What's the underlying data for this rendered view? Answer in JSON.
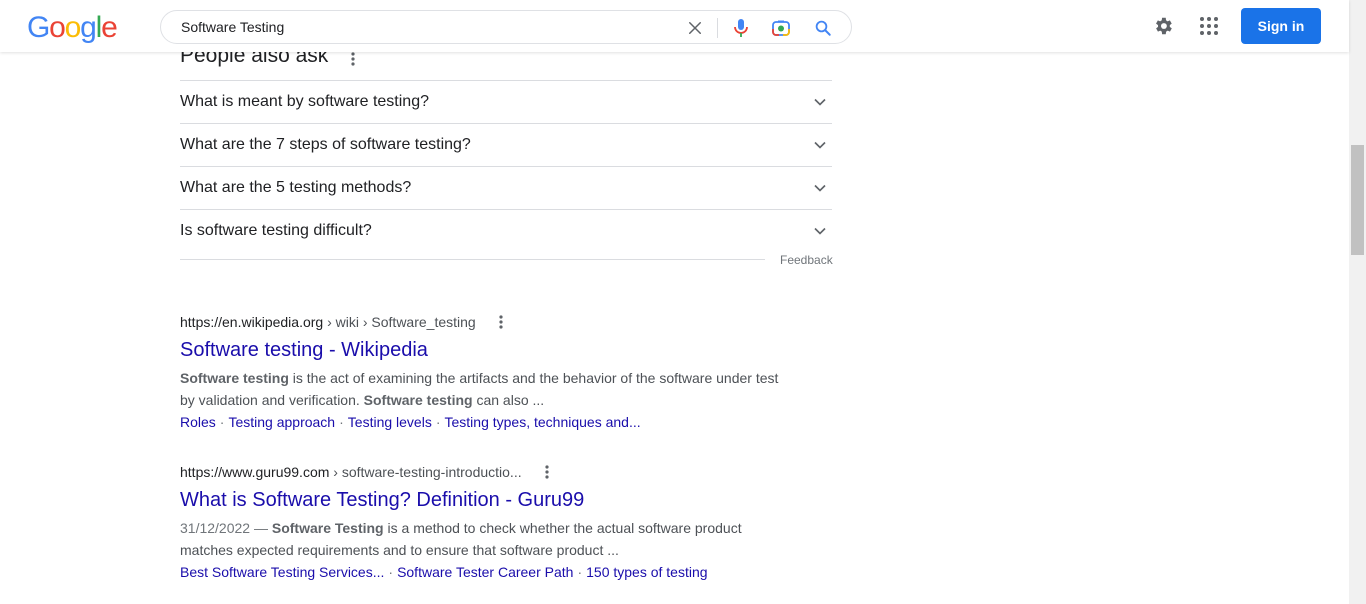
{
  "header": {
    "logo_letters": [
      {
        "ch": "G",
        "color": "#4285f4"
      },
      {
        "ch": "o",
        "color": "#ea4335"
      },
      {
        "ch": "o",
        "color": "#fbbc05"
      },
      {
        "ch": "g",
        "color": "#4285f4"
      },
      {
        "ch": "l",
        "color": "#34a853"
      },
      {
        "ch": "e",
        "color": "#ea4335"
      }
    ],
    "search_value": "Software Testing",
    "signin_label": "Sign in",
    "icons": [
      "clear-icon",
      "microphone-icon",
      "camera-lens-icon",
      "search-icon",
      "settings-gear-icon",
      "apps-grid-icon"
    ]
  },
  "paa": {
    "title": "People also ask",
    "questions": [
      "What is meant by software testing?",
      "What are the 7 steps of software testing?",
      "What are the 5 testing methods?",
      "Is software testing difficult?"
    ],
    "feedback": "Feedback"
  },
  "results": [
    {
      "domain": "https://en.wikipedia.org",
      "path": " › wiki › Software_testing",
      "title": "Software testing - Wikipedia",
      "snippet": [
        {
          "b": "Software testing"
        },
        {
          "t": " is the act of examining the artifacts and the behavior of the software under test by validation and verification. "
        },
        {
          "b": "Software testing"
        },
        {
          "t": " can also ..."
        }
      ],
      "sitelinks": [
        "Roles",
        "Testing approach",
        "Testing levels",
        "Testing types, techniques and..."
      ]
    },
    {
      "domain": "https://www.guru99.com",
      "path": " › software-testing-introductio...",
      "title": "What is Software Testing? Definition - Guru99",
      "date": "31/12/2022 — ",
      "snippet": [
        {
          "b": "Software Testing"
        },
        {
          "t": " is a method to check whether the actual software product matches expected requirements and to ensure that software product ..."
        }
      ],
      "sitelinks": [
        "Best Software Testing Services...",
        "Software Tester Career Path",
        "150 types of testing"
      ]
    }
  ],
  "colors": {
    "link": "#1a0dab",
    "accent": "#1a73e8",
    "text": "#202124",
    "muted": "#4d5156"
  }
}
